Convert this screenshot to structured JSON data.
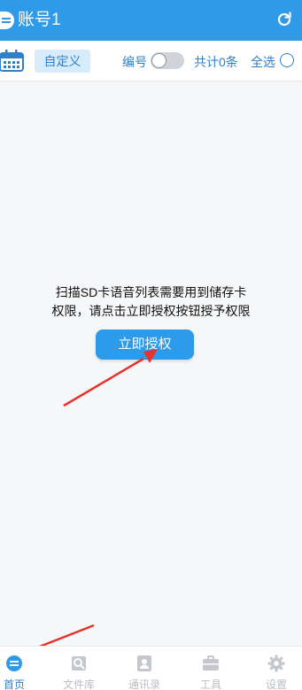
{
  "header": {
    "title": "账号1",
    "refresh_icon": "refresh-icon",
    "back_icon": "back-icon"
  },
  "toolbar": {
    "custom_label": "自定义",
    "number_label": "编号",
    "number_toggle_on": false,
    "count_label": "共计0条",
    "select_all_label": "全选"
  },
  "main": {
    "message_line1": "扫描SD卡语音列表需要用到储存卡",
    "message_line2": "权限，请点击立即授权按钮授予权限",
    "authorize_label": "立即授权"
  },
  "tabs": [
    {
      "label": "首页",
      "icon": "home-icon",
      "active": true
    },
    {
      "label": "文件库",
      "icon": "file-library-icon",
      "active": false
    },
    {
      "label": "通讯录",
      "icon": "contacts-icon",
      "active": false
    },
    {
      "label": "工具",
      "icon": "toolbox-icon",
      "active": false
    },
    {
      "label": "设置",
      "icon": "settings-gear-icon",
      "active": false
    }
  ],
  "colors": {
    "accent": "#2f9be8",
    "annotation_arrow": "#e8322b",
    "inactive_tab": "#b9bdc2"
  }
}
